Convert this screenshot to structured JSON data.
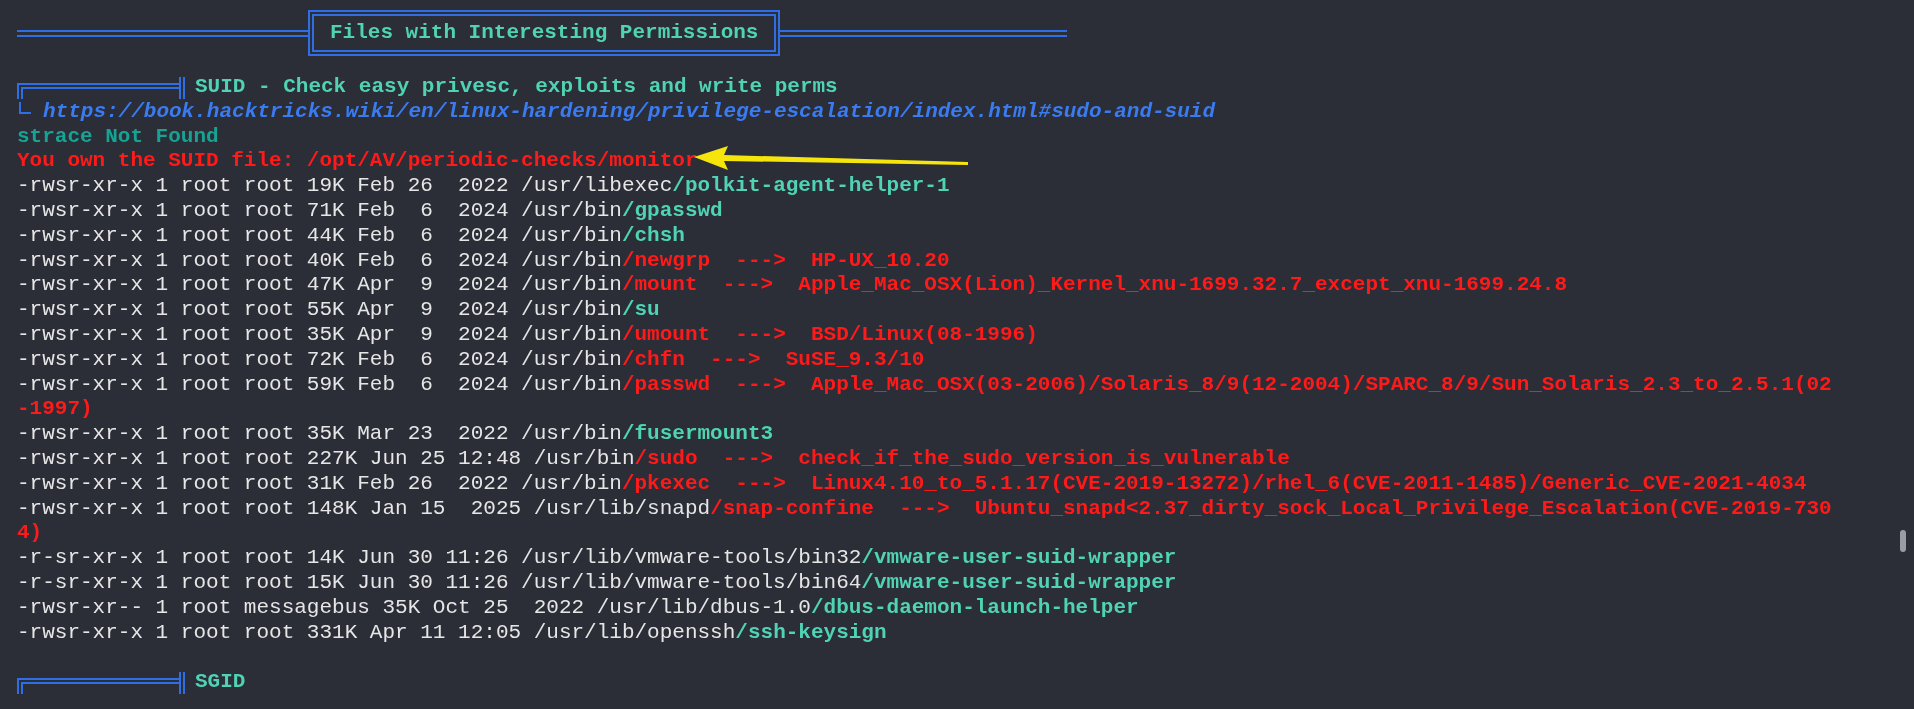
{
  "banner": {
    "title": "Files with Interesting Permissions"
  },
  "sections": [
    {
      "title": "SUID - Check easy privesc, exploits and write perms",
      "link": "https://book.hacktricks.wiki/en/linux-hardening/privilege-escalation/index.html#sudo-and-suid",
      "lines": [
        [
          {
            "kind": "status",
            "text": "strace Not Found"
          }
        ],
        [
          {
            "kind": "alert",
            "text": "You own the SUID file: /opt/AV/periodic-checks/monitor"
          }
        ],
        [
          {
            "kind": "plain",
            "text": "-rwsr-xr-x 1 root root 19K Feb 26  2022 /usr/libexec"
          },
          {
            "kind": "path",
            "text": "/polkit-agent-helper-1"
          }
        ],
        [
          {
            "kind": "plain",
            "text": "-rwsr-xr-x 1 root root 71K Feb  6  2024 /usr/bin"
          },
          {
            "kind": "path",
            "text": "/gpasswd"
          }
        ],
        [
          {
            "kind": "plain",
            "text": "-rwsr-xr-x 1 root root 44K Feb  6  2024 /usr/bin"
          },
          {
            "kind": "path",
            "text": "/chsh"
          }
        ],
        [
          {
            "kind": "plain",
            "text": "-rwsr-xr-x 1 root root 40K Feb  6  2024 /usr/bin"
          },
          {
            "kind": "vuln",
            "text": "/newgrp  --->  HP-UX_10.20"
          }
        ],
        [
          {
            "kind": "plain",
            "text": "-rwsr-xr-x 1 root root 47K Apr  9  2024 /usr/bin"
          },
          {
            "kind": "vuln",
            "text": "/mount  --->  Apple_Mac_OSX(Lion)_Kernel_xnu-1699.32.7_except_xnu-1699.24.8"
          }
        ],
        [
          {
            "kind": "plain",
            "text": "-rwsr-xr-x 1 root root 55K Apr  9  2024 /usr/bin"
          },
          {
            "kind": "path",
            "text": "/su"
          }
        ],
        [
          {
            "kind": "plain",
            "text": "-rwsr-xr-x 1 root root 35K Apr  9  2024 /usr/bin"
          },
          {
            "kind": "vuln",
            "text": "/umount  --->  BSD/Linux(08-1996)"
          }
        ],
        [
          {
            "kind": "plain",
            "text": "-rwsr-xr-x 1 root root 72K Feb  6  2024 /usr/bin"
          },
          {
            "kind": "vuln",
            "text": "/chfn  --->  SuSE_9.3/10"
          }
        ],
        [
          {
            "kind": "plain",
            "text": "-rwsr-xr-x 1 root root 59K Feb  6  2024 /usr/bin"
          },
          {
            "kind": "vuln",
            "text": "/passwd  --->  Apple_Mac_OSX(03-2006)/Solaris_8/9(12-2004)/SPARC_8/9/Sun_Solaris_2.3_to_2.5.1(02-1997)"
          }
        ],
        [
          {
            "kind": "plain",
            "text": "-rwsr-xr-x 1 root root 35K Mar 23  2022 /usr/bin"
          },
          {
            "kind": "path",
            "text": "/fusermount3"
          }
        ],
        [
          {
            "kind": "plain",
            "text": "-rwsr-xr-x 1 root root 227K Jun 25 12:48 /usr/bin"
          },
          {
            "kind": "vuln",
            "text": "/sudo  --->  check_if_the_sudo_version_is_vulnerable"
          }
        ],
        [
          {
            "kind": "plain",
            "text": "-rwsr-xr-x 1 root root 31K Feb 26  2022 /usr/bin"
          },
          {
            "kind": "vuln",
            "text": "/pkexec  --->  Linux4.10_to_5.1.17(CVE-2019-13272)/rhel_6(CVE-2011-1485)/Generic_CVE-2021-4034"
          }
        ],
        [
          {
            "kind": "plain",
            "text": "-rwsr-xr-x 1 root root 148K Jan 15  2025 /usr/lib/snapd"
          },
          {
            "kind": "vuln",
            "text": "/snap-confine  --->  Ubuntu_snapd<2.37_dirty_sock_Local_Privilege_Escalation(CVE-2019-7304)"
          }
        ],
        [
          {
            "kind": "plain",
            "text": "-r-sr-xr-x 1 root root 14K Jun 30 11:26 /usr/lib/vmware-tools/bin32"
          },
          {
            "kind": "path",
            "text": "/vmware-user-suid-wrapper"
          }
        ],
        [
          {
            "kind": "plain",
            "text": "-r-sr-xr-x 1 root root 15K Jun 30 11:26 /usr/lib/vmware-tools/bin64"
          },
          {
            "kind": "path",
            "text": "/vmware-user-suid-wrapper"
          }
        ],
        [
          {
            "kind": "plain",
            "text": "-rwsr-xr-- 1 root messagebus 35K Oct 25  2022 /usr/lib/dbus-1.0"
          },
          {
            "kind": "path",
            "text": "/dbus-daemon-launch-helper"
          }
        ],
        [
          {
            "kind": "plain",
            "text": "-rwsr-xr-x 1 root root 331K Apr 11 12:05 /usr/lib/openssh"
          },
          {
            "kind": "path",
            "text": "/ssh-keysign"
          }
        ]
      ]
    },
    {
      "title": "SGID"
    }
  ]
}
